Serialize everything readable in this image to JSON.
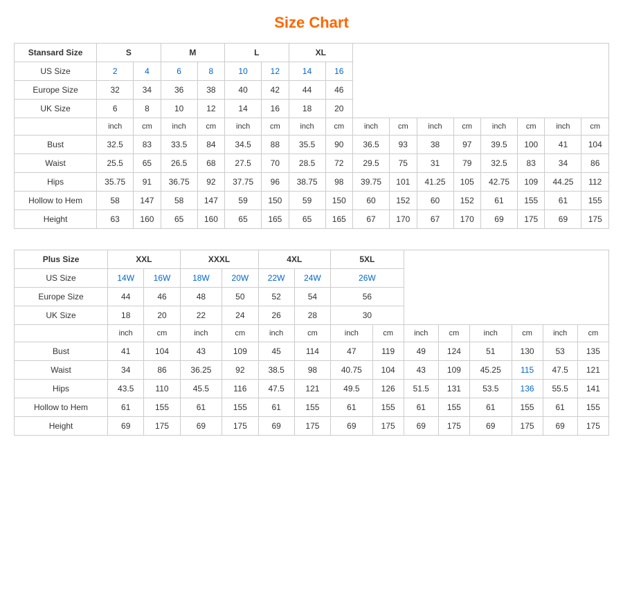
{
  "title": "Size Chart",
  "standard": {
    "header": "Stansard Size",
    "columns": [
      "S",
      "M",
      "L",
      "XL"
    ],
    "subcolumns": [
      "2",
      "4",
      "6",
      "8",
      "10",
      "12",
      "14",
      "16"
    ],
    "europe": [
      "32",
      "34",
      "36",
      "38",
      "40",
      "42",
      "44",
      "46"
    ],
    "uk": [
      "6",
      "8",
      "10",
      "12",
      "14",
      "16",
      "18",
      "20"
    ],
    "measurements": [
      {
        "label": "Bust",
        "values": [
          "32.5",
          "83",
          "33.5",
          "84",
          "34.5",
          "88",
          "35.5",
          "90",
          "36.5",
          "93",
          "38",
          "97",
          "39.5",
          "100",
          "41",
          "104"
        ]
      },
      {
        "label": "Waist",
        "values": [
          "25.5",
          "65",
          "26.5",
          "68",
          "27.5",
          "70",
          "28.5",
          "72",
          "29.5",
          "75",
          "31",
          "79",
          "32.5",
          "83",
          "34",
          "86"
        ]
      },
      {
        "label": "Hips",
        "values": [
          "35.75",
          "91",
          "36.75",
          "92",
          "37.75",
          "96",
          "38.75",
          "98",
          "39.75",
          "101",
          "41.25",
          "105",
          "42.75",
          "109",
          "44.25",
          "112"
        ]
      },
      {
        "label": "Hollow to Hem",
        "values": [
          "58",
          "147",
          "58",
          "147",
          "59",
          "150",
          "59",
          "150",
          "60",
          "152",
          "60",
          "152",
          "61",
          "155",
          "61",
          "155"
        ]
      },
      {
        "label": "Height",
        "values": [
          "63",
          "160",
          "65",
          "160",
          "65",
          "165",
          "65",
          "165",
          "67",
          "170",
          "67",
          "170",
          "69",
          "175",
          "69",
          "175"
        ]
      }
    ]
  },
  "plus": {
    "header": "Plus Size",
    "columns": [
      "XXL",
      "XXXL",
      "4XL",
      "5XL"
    ],
    "subcolumns": [
      "14W",
      "16W",
      "18W",
      "20W",
      "22W",
      "24W",
      "26W"
    ],
    "europe": [
      "44",
      "46",
      "48",
      "50",
      "52",
      "54",
      "56"
    ],
    "uk": [
      "18",
      "20",
      "22",
      "24",
      "26",
      "28",
      "30"
    ],
    "measurements": [
      {
        "label": "Bust",
        "values": [
          "41",
          "104",
          "43",
          "109",
          "45",
          "114",
          "47",
          "119",
          "49",
          "124",
          "51",
          "130",
          "53",
          "135"
        ]
      },
      {
        "label": "Waist",
        "values": [
          "34",
          "86",
          "36.25",
          "92",
          "38.5",
          "98",
          "40.75",
          "104",
          "43",
          "109",
          "45.25",
          "115",
          "47.5",
          "121"
        ]
      },
      {
        "label": "Hips",
        "values": [
          "43.5",
          "110",
          "45.5",
          "116",
          "47.5",
          "121",
          "49.5",
          "126",
          "51.5",
          "131",
          "53.5",
          "136",
          "55.5",
          "141"
        ]
      },
      {
        "label": "Hollow to Hem",
        "values": [
          "61",
          "155",
          "61",
          "155",
          "61",
          "155",
          "61",
          "155",
          "61",
          "155",
          "61",
          "155",
          "61",
          "155"
        ]
      },
      {
        "label": "Height",
        "values": [
          "69",
          "175",
          "69",
          "175",
          "69",
          "175",
          "69",
          "175",
          "69",
          "175",
          "69",
          "175",
          "69",
          "175"
        ]
      }
    ]
  }
}
